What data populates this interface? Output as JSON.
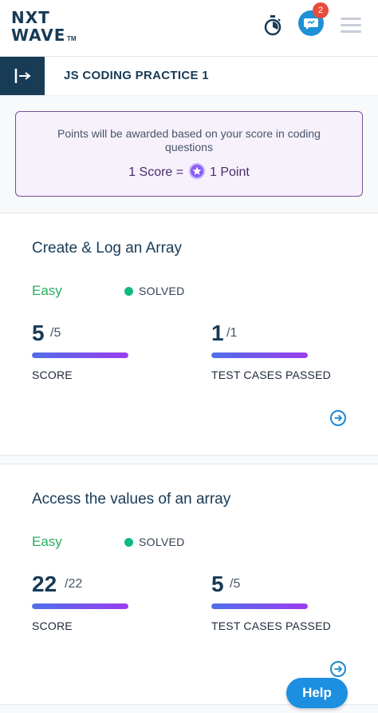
{
  "header": {
    "logo_line1": "NXT",
    "logo_line2": "WAVE",
    "logo_tm": "TM",
    "notification_count": "2",
    "icons": [
      "stopwatch-icon",
      "chat-icon",
      "hamburger-menu-icon"
    ]
  },
  "titlebar": {
    "title": "JS CODING PRACTICE 1"
  },
  "info": {
    "message": "Points will be awarded based on your score in coding questions",
    "score_left": "1 Score =",
    "score_right": "1 Point"
  },
  "questions": [
    {
      "title": "Create & Log an Array",
      "difficulty": "Easy",
      "status": "SOLVED",
      "score": "5",
      "score_total": "/5",
      "score_fraction": 1.0,
      "score_label": "SCORE",
      "tests": "1",
      "tests_total": "/1",
      "tests_fraction": 1.0,
      "tests_label": "TEST CASES PASSED"
    },
    {
      "title": "Access the values of an array",
      "difficulty": "Easy",
      "status": "SOLVED",
      "score": "22",
      "score_total": "/22",
      "score_fraction": 1.0,
      "score_label": "SCORE",
      "tests": "5",
      "tests_total": "/5",
      "tests_fraction": 1.0,
      "tests_label": "TEST CASES PASSED"
    }
  ],
  "help_label": "Help",
  "colors": {
    "brand_dark": "#183b56",
    "easy_green": "#27ae60",
    "solved_dot": "#10b981",
    "accent_blue": "#1d8fe0",
    "info_border": "#7a5196"
  }
}
